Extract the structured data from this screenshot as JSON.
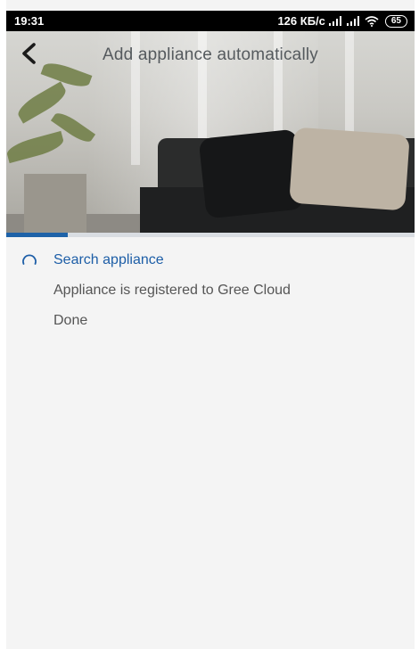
{
  "status_bar": {
    "time": "19:31",
    "network_speed": "126 КБ/с",
    "battery": "65",
    "icons": [
      "signal-icon",
      "signal-icon",
      "wifi-icon",
      "battery-icon"
    ]
  },
  "header": {
    "title": "Add appliance automatically",
    "back_icon": "back-arrow-icon"
  },
  "progress": {
    "fraction": 0.15
  },
  "steps": [
    {
      "label": "Search appliance",
      "state": "active"
    },
    {
      "label": "Appliance is registered to Gree Cloud",
      "state": "pending"
    },
    {
      "label": "Done",
      "state": "pending"
    }
  ],
  "colors": {
    "accent": "#1d5ea7",
    "background": "#f4f4f4",
    "text": "#555555"
  }
}
